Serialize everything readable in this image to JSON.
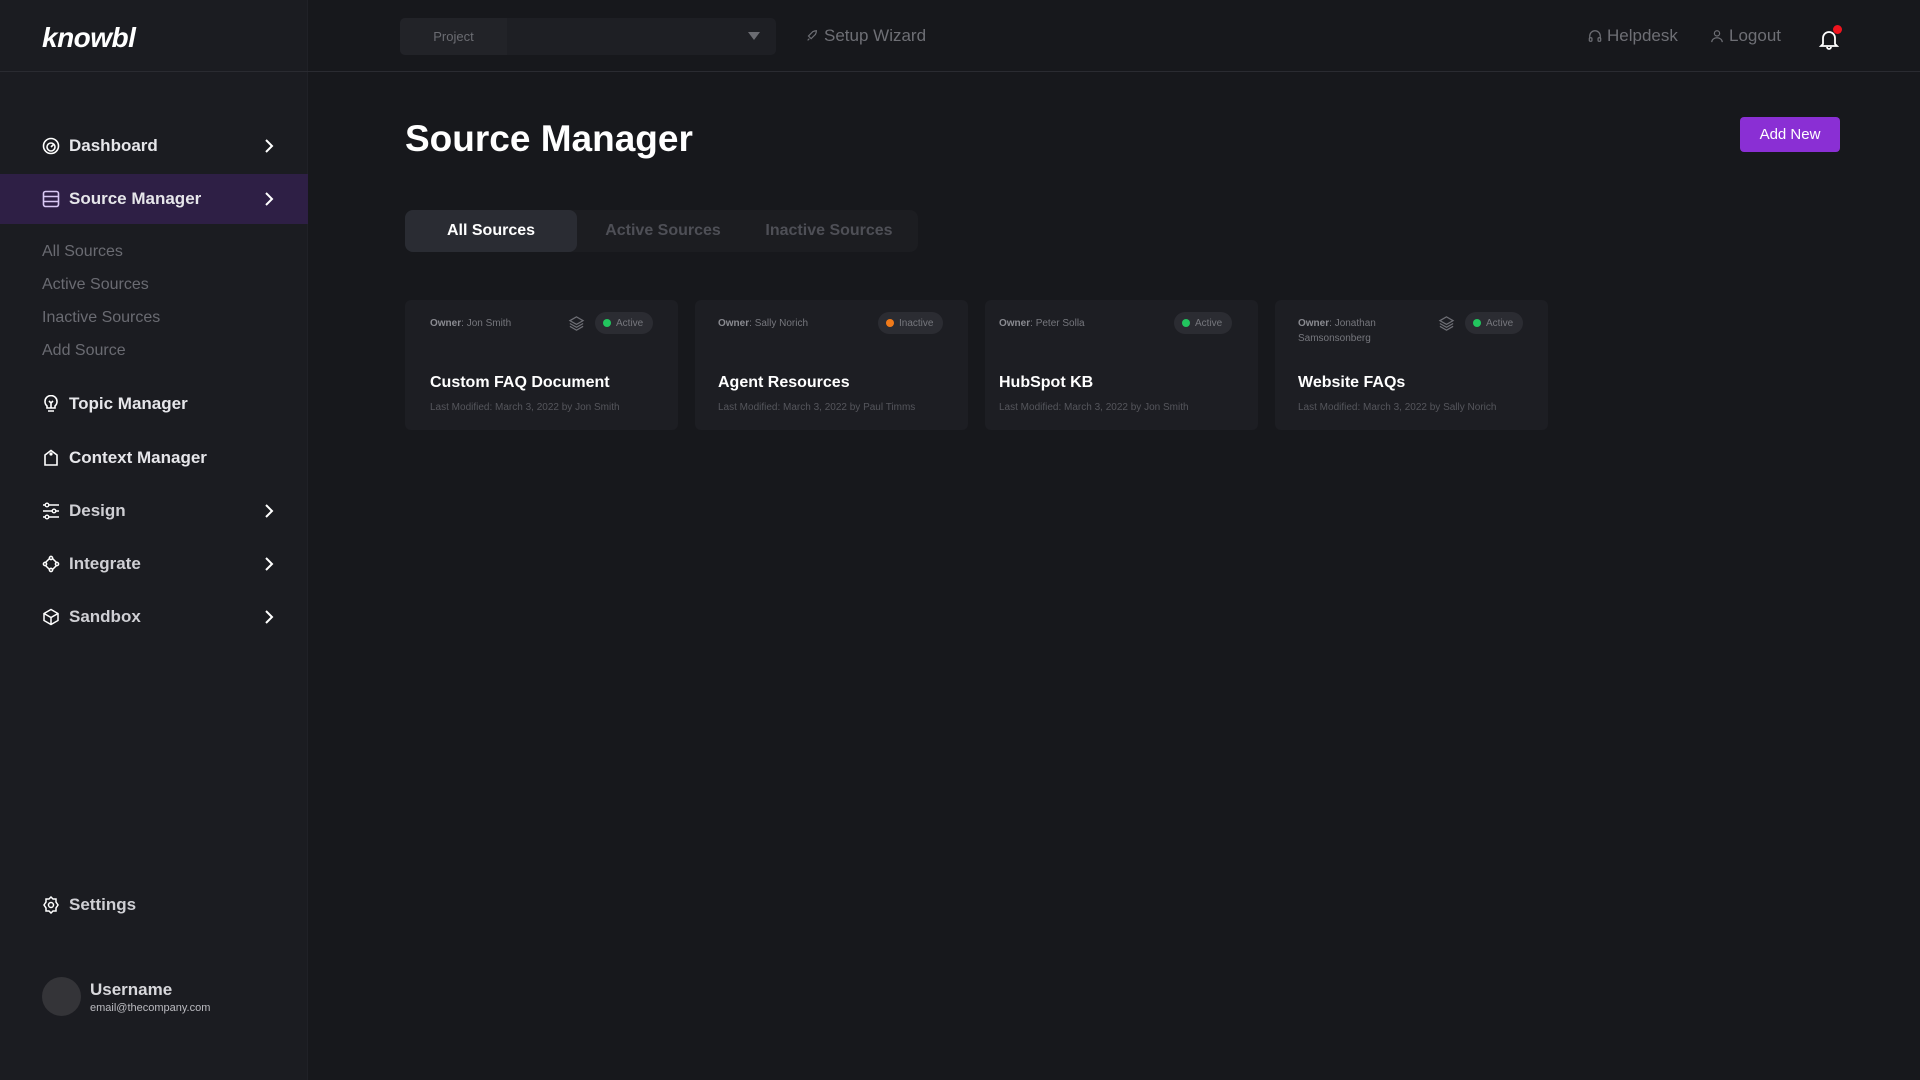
{
  "app": {
    "logo": "knowbl"
  },
  "topbar": {
    "project_select": {
      "label": "Project",
      "value": ""
    },
    "setup_wizard": "Setup Wizard",
    "helpdesk": "Helpdesk",
    "logout": "Logout",
    "notifications": {
      "has_unread": true,
      "dot_color": "#f0141e"
    }
  },
  "sidebar": {
    "items": [
      {
        "label": "Dashboard",
        "icon": "dashboard-gauge-icon",
        "has_chevron": true
      },
      {
        "label": "Source Manager",
        "icon": "database-icon",
        "has_chevron": true,
        "active": true,
        "children": [
          "All Sources",
          "Active Sources",
          "Inactive Sources",
          "Add Source"
        ]
      },
      {
        "label": "Topic Manager",
        "icon": "lightbulb-icon",
        "has_chevron": false
      },
      {
        "label": "Context Manager",
        "icon": "tag-icon",
        "has_chevron": false
      },
      {
        "label": "Design",
        "icon": "sliders-icon",
        "has_chevron": true
      },
      {
        "label": "Integrate",
        "icon": "integrate-icon",
        "has_chevron": true
      },
      {
        "label": "Sandbox",
        "icon": "cube-icon",
        "has_chevron": true
      }
    ],
    "settings": "Settings",
    "user": {
      "name": "Username",
      "email": "email@thecompany.com"
    }
  },
  "main": {
    "title": "Source Manager",
    "add_button": "Add New",
    "tabs": [
      {
        "label": "All Sources",
        "active": true
      },
      {
        "label": "Active Sources",
        "active": false
      },
      {
        "label": "Inactive Sources",
        "active": false
      }
    ],
    "cards": [
      {
        "owner_label": "Owner",
        "owner": "Jon Smith",
        "status": "Active",
        "status_color": "#22c55e",
        "layers": true,
        "title": "Custom FAQ Document",
        "modified": "Last Modified: March 3, 2022 by Jon Smith"
      },
      {
        "owner_label": "Owner",
        "owner": "Sally Norich",
        "status": "Inactive",
        "status_color": "#f07a1a",
        "layers": false,
        "title": "Agent Resources",
        "modified": "Last Modified: March 3, 2022 by Paul Timms"
      },
      {
        "owner_label": "Owner",
        "owner": "Peter Solla",
        "status": "Active",
        "status_color": "#22c55e",
        "layers": false,
        "title": "HubSpot KB",
        "modified": "Last Modified: March 3, 2022 by Jon Smith"
      },
      {
        "owner_label": "Owner",
        "owner": "Jonathan Samsonsonberg",
        "status": "Active",
        "status_color": "#22c55e",
        "layers": true,
        "title": "Website FAQs",
        "modified": "Last Modified: March 3, 2022 by Sally Norich"
      }
    ]
  }
}
